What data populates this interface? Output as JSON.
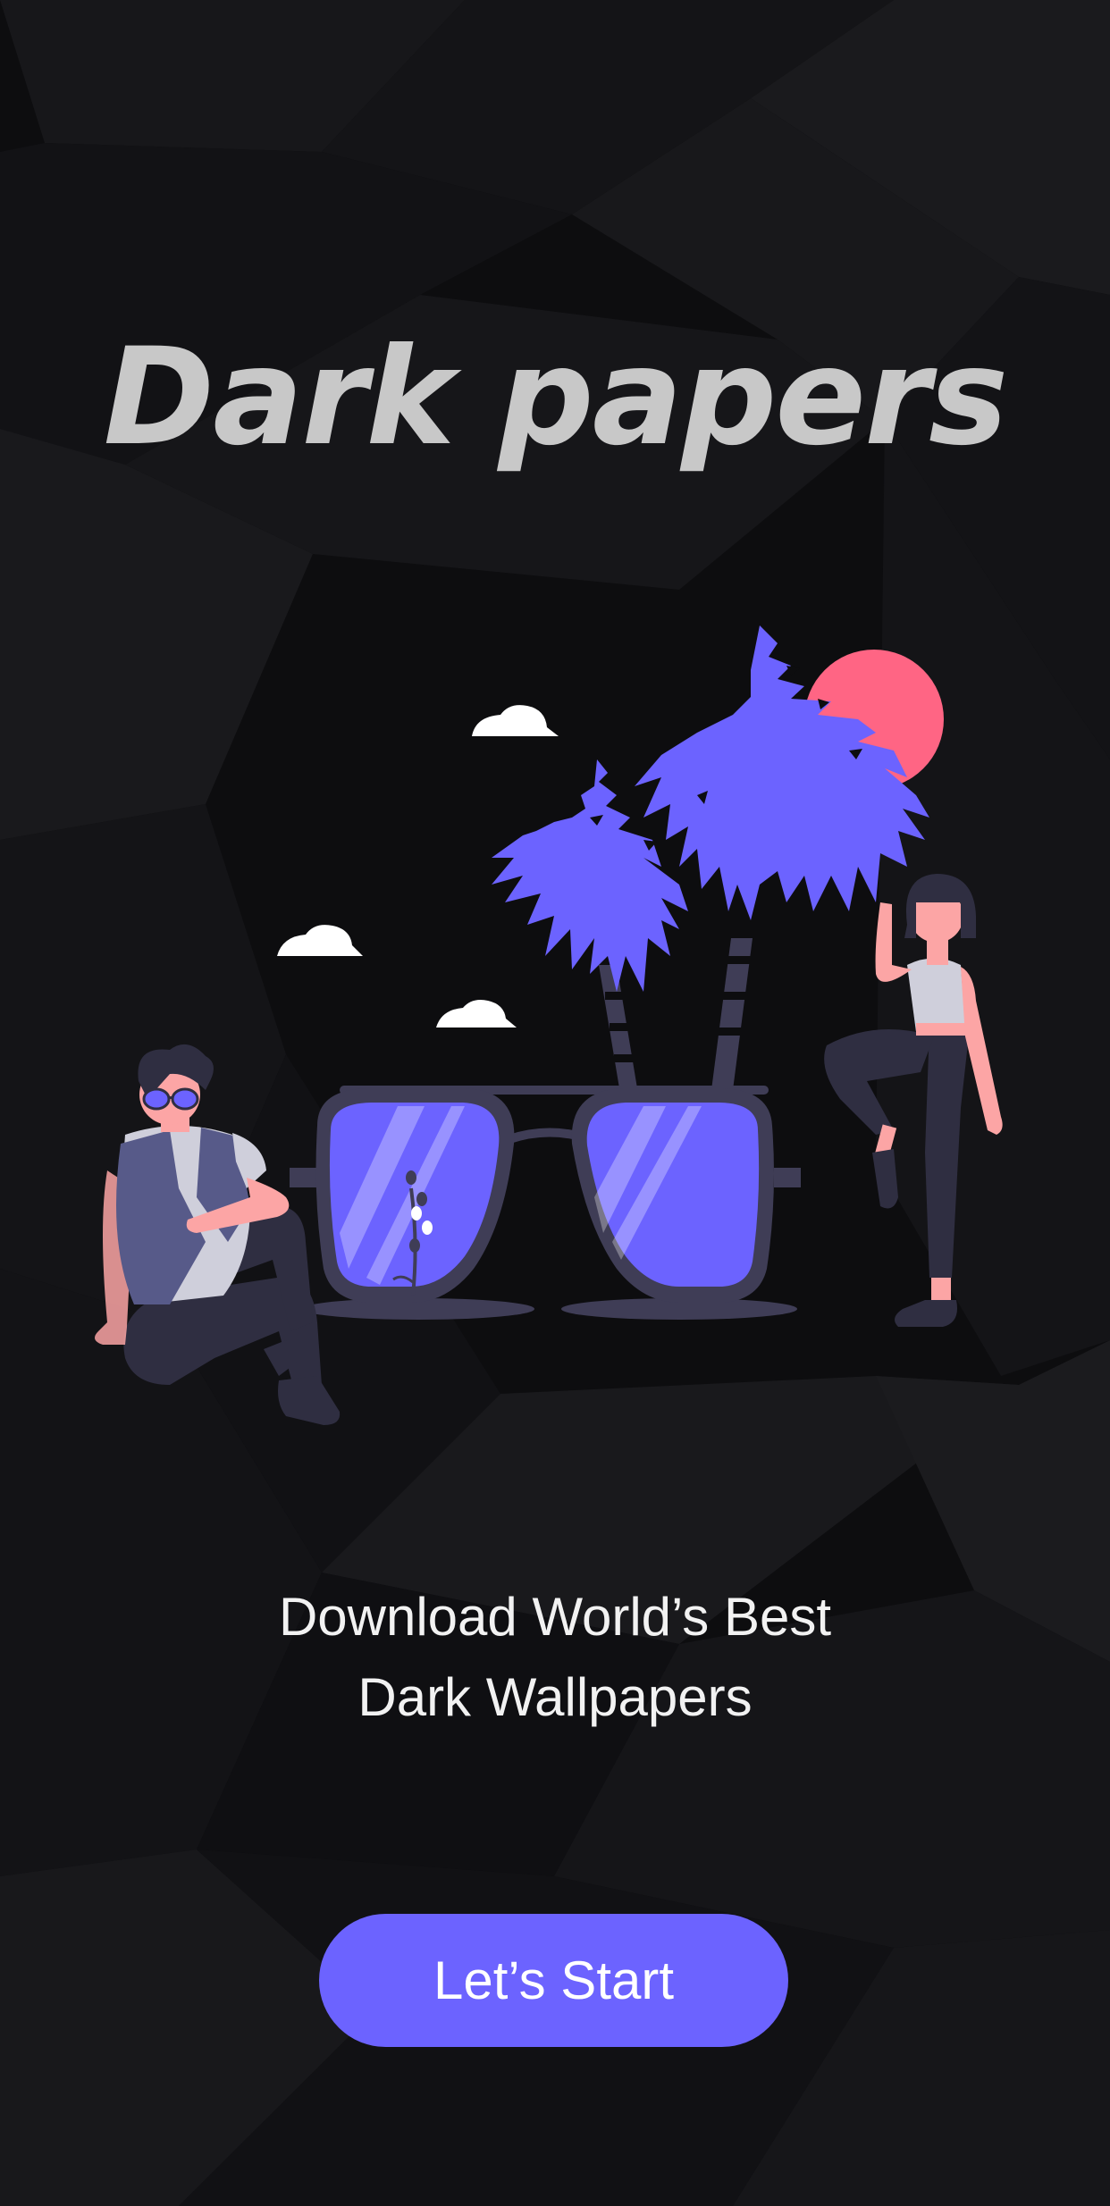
{
  "app": {
    "title": "Dark papers"
  },
  "tagline": {
    "line1": "Download World’s Best",
    "line2": "Dark Wallpapers"
  },
  "start_button": {
    "label": "Let’s Start"
  },
  "colors": {
    "background": "#0d0d0f",
    "title": "#c8c8c8",
    "accent": "#6c63ff",
    "sun": "#ff6584",
    "text": "#f2f2f2"
  },
  "illustration": {
    "icon": "sunglasses-palm-trees-people-illustration"
  }
}
